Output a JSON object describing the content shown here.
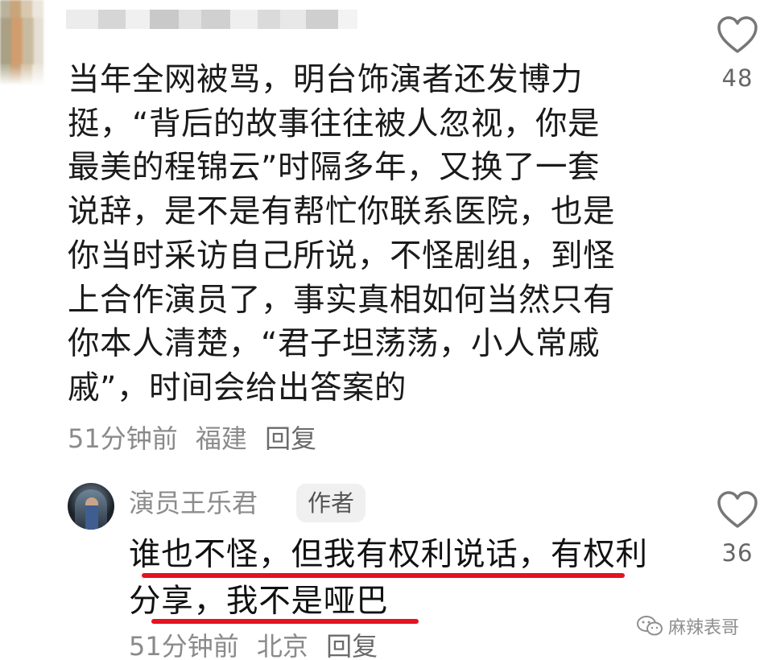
{
  "comment": {
    "lines": [
      "当年全网被骂，明台饰演者还发博力",
      "挺，“背后的故事往往被人忽视，你是",
      "最美的程锦云”时隔多年，又换了一套",
      "说辞，是不是有帮忙你联系医院，也是",
      "你当时采访自己所说，不怪剧组，到怪",
      "上合作演员了，事实真相如何当然只有",
      "你本人清楚，“君子坦荡荡，小人常戚",
      "戚”，时间会给出答案的"
    ],
    "time": "51分钟前",
    "location": "福建",
    "reply_label": "回复",
    "likes": "48"
  },
  "reply": {
    "author_name": "演员王乐君",
    "author_badge": "作者",
    "lines": [
      "谁也不怪，但我有权利说话，有权利",
      "分享，我不是哑巴"
    ],
    "time": "51分钟前",
    "location": "北京",
    "reply_label": "回复",
    "likes": "36"
  },
  "watermark": {
    "icon": "wechat-icon",
    "text": "麻辣表哥"
  },
  "colors": {
    "underline": "#e5121f",
    "meta_text": "#8a8a8a",
    "body_text": "#1a1a1a"
  }
}
